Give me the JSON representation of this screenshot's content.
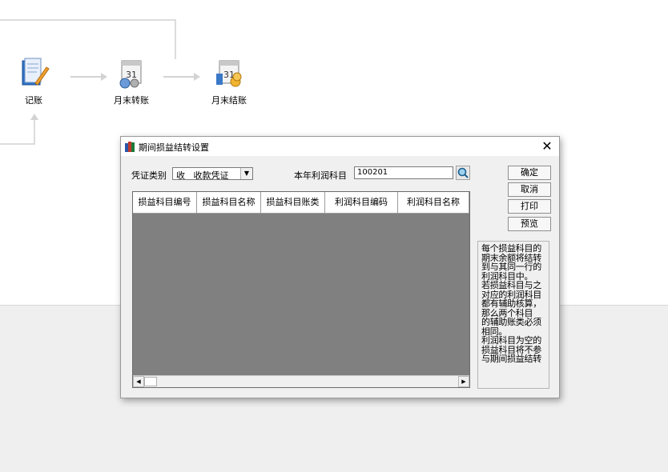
{
  "flow": {
    "nodes": [
      {
        "label": "记账",
        "icon": "ledger-pen-icon"
      },
      {
        "label": "月末转账",
        "icon": "calendar-transfer-icon"
      },
      {
        "label": "月末结账",
        "icon": "calendar-coins-icon"
      }
    ]
  },
  "dialog": {
    "title": "期间损益结转设置",
    "close_symbol": "✕",
    "voucher_type_label": "凭证类别",
    "voucher_type_value": "收   收款凭证",
    "profit_account_label": "本年利润科目",
    "profit_account_value": "100201",
    "grid": {
      "columns": [
        "损益科目编号",
        "损益科目名称",
        "损益科目账类",
        "利润科目编码",
        "利润科目名称"
      ],
      "rows": []
    },
    "buttons": {
      "ok": "确定",
      "cancel": "取消",
      "print": "打印",
      "preview": "预览"
    },
    "note_lines": [
      "每个损益科目的",
      "期末余额将结转",
      "到与其同一行的",
      "利润科目中。",
      "若损益科目与之",
      "对应的利润科目",
      "都有辅助核算，",
      "那么两个科目",
      "的辅助账类必须",
      "相同。",
      "利润科目为空的",
      "损益科目将不参",
      "与期间损益结转"
    ]
  }
}
